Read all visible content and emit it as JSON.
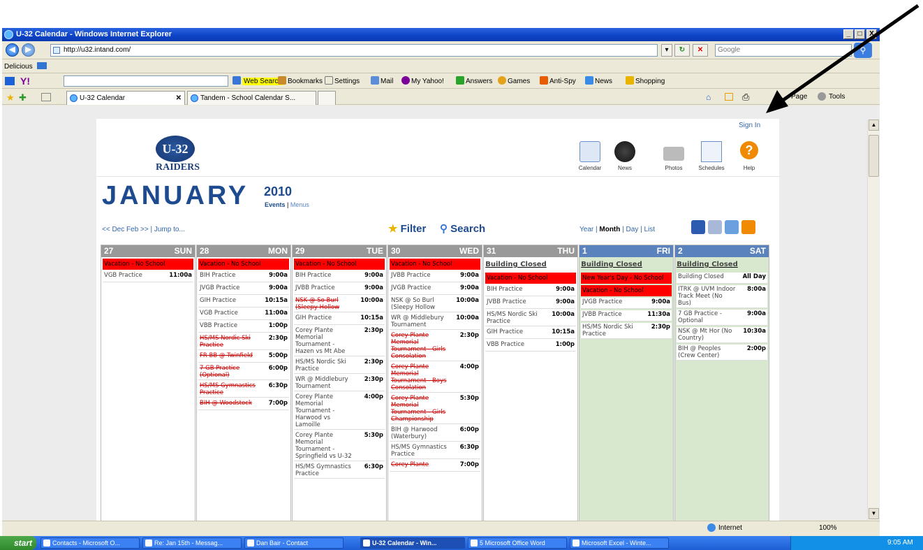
{
  "window": {
    "title": "U-32 Calendar - Windows Internet Explorer",
    "min": "_",
    "max": "□",
    "close": "X"
  },
  "address": {
    "url": "http://u32.intand.com/",
    "search_placeholder": "Google"
  },
  "delicious": {
    "label": "Delicious"
  },
  "yahoo_toolbar": {
    "items": [
      "Web Search",
      "Bookmarks",
      "Settings",
      "Mail",
      "My Yahoo!",
      "Answers",
      "Games",
      "Anti-Spy",
      "News",
      "Shopping"
    ]
  },
  "tabs": {
    "tab1": "U-32 Calendar",
    "tab2": "Tandem - School Calendar S...",
    "page_menu": "Page",
    "tools_menu": "Tools"
  },
  "page": {
    "sign_in": "Sign In",
    "logo": "U-32",
    "raiders": "RAIDERS",
    "nav": [
      "Calendar",
      "News",
      "Photos",
      "Schedules",
      "Help"
    ],
    "month": "JANUARY",
    "year": "2010",
    "events_link": "Events",
    "sep": "|",
    "menus_link": "Menus",
    "prev_next": "<< Dec   Feb >>  |  Jump to...",
    "filter": "Filter",
    "search": "Search",
    "views": {
      "year": "Year",
      "month": "Month",
      "day": "Day",
      "list": "List"
    }
  },
  "calendar": {
    "days": [
      {
        "num": "27",
        "name": "SUN",
        "events": [
          {
            "name": "Vacation - No School",
            "time": "",
            "style": "red"
          },
          {
            "name": "VGB Practice",
            "time": "11:00a",
            "style": ""
          }
        ]
      },
      {
        "num": "28",
        "name": "MON",
        "events": [
          {
            "name": "Vacation - No School",
            "time": "",
            "style": "red"
          },
          {
            "name": "BIH Practice",
            "time": "9:00a",
            "style": ""
          },
          {
            "name": "JVGB Practice",
            "time": "9:00a",
            "style": ""
          },
          {
            "name": "GIH Practice",
            "time": "10:15a",
            "style": ""
          },
          {
            "name": "VGB Practice",
            "time": "11:00a",
            "style": ""
          },
          {
            "name": "VBB Practice",
            "time": "1:00p",
            "style": ""
          },
          {
            "name": "HS/MS Nordic Ski Practice",
            "time": "2:30p",
            "style": "x"
          },
          {
            "name": "FR BB @ Twinfield",
            "time": "5:00p",
            "style": "x"
          },
          {
            "name": "7 GB Practice (Optional)",
            "time": "6:00p",
            "style": "x"
          },
          {
            "name": "HS/MS Gymnastics Practice",
            "time": "6:30p",
            "style": "x"
          },
          {
            "name": "BIH @ Woodstock",
            "time": "7:00p",
            "style": "x"
          }
        ]
      },
      {
        "num": "29",
        "name": "TUE",
        "events": [
          {
            "name": "Vacation - No School",
            "time": "",
            "style": "red"
          },
          {
            "name": "BIH Practice",
            "time": "9:00a",
            "style": ""
          },
          {
            "name": "JVBB Practice",
            "time": "9:00a",
            "style": ""
          },
          {
            "name": "NSK @ So Burl (Sleepy Hollow",
            "time": "10:00a",
            "style": "x"
          },
          {
            "name": "GIH Practice",
            "time": "10:15a",
            "style": ""
          },
          {
            "name": "Corey Plante Memorial Tournament - Hazen vs Mt Abe",
            "time": "2:30p",
            "style": ""
          },
          {
            "name": "HS/MS Nordic Ski Practice",
            "time": "2:30p",
            "style": ""
          },
          {
            "name": "WR @ Middlebury Tournament",
            "time": "2:30p",
            "style": ""
          },
          {
            "name": "Corey Plante Memorial Tournament - Harwood vs Lamoille",
            "time": "4:00p",
            "style": ""
          },
          {
            "name": "Corey Plante Memorial Tournament - Springfield vs U-32",
            "time": "5:30p",
            "style": ""
          },
          {
            "name": "HS/MS Gymnastics Practice",
            "time": "6:30p",
            "style": ""
          }
        ]
      },
      {
        "num": "30",
        "name": "WED",
        "events": [
          {
            "name": "Vacation - No School",
            "time": "",
            "style": "red"
          },
          {
            "name": "JVBB Practice",
            "time": "9:00a",
            "style": ""
          },
          {
            "name": "JVGB Practice",
            "time": "9:00a",
            "style": ""
          },
          {
            "name": "NSK @ So Burl (Sleepy Hollow",
            "time": "10:00a",
            "style": ""
          },
          {
            "name": "WR @ Middlebury Tournament",
            "time": "10:00a",
            "style": ""
          },
          {
            "name": "Corey Plante Memorial Tournament - Girls Consolation",
            "time": "2:30p",
            "style": "x"
          },
          {
            "name": "Corey Plante Memorial Tournament - Boys Consolation",
            "time": "4:00p",
            "style": "x"
          },
          {
            "name": "Corey Plante Memorial Tournament - Girls Championship",
            "time": "5:30p",
            "style": "x"
          },
          {
            "name": "BIH @ Harwood (Waterbury)",
            "time": "6:00p",
            "style": ""
          },
          {
            "name": "HS/MS Gymnastics Practice",
            "time": "6:30p",
            "style": ""
          },
          {
            "name": "Corey Plante",
            "time": "7:00p",
            "style": "x"
          }
        ]
      },
      {
        "num": "31",
        "name": "THU",
        "events": [
          {
            "name": "Building Closed",
            "time": "",
            "style": "closed"
          },
          {
            "name": "Vacation - No School",
            "time": "",
            "style": "red"
          },
          {
            "name": "BIH Practice",
            "time": "9:00a",
            "style": ""
          },
          {
            "name": "JVBB Practice",
            "time": "9:00a",
            "style": ""
          },
          {
            "name": "HS/MS Nordic Ski Practice",
            "time": "10:00a",
            "style": ""
          },
          {
            "name": "GIH Practice",
            "time": "10:15a",
            "style": ""
          },
          {
            "name": "VBB Practice",
            "time": "1:00p",
            "style": ""
          }
        ]
      },
      {
        "num": "1",
        "name": "FRI",
        "highlight": true,
        "events": [
          {
            "name": "Building Closed",
            "time": "",
            "style": "closed"
          },
          {
            "name": "New Year's Day - No School",
            "time": "",
            "style": "red"
          },
          {
            "name": "Vacation - No School",
            "time": "",
            "style": "red"
          },
          {
            "name": "JVGB Practice",
            "time": "9:00a",
            "style": ""
          },
          {
            "name": "JVBB Practice",
            "time": "11:30a",
            "style": ""
          },
          {
            "name": "HS/MS Nordic Ski Practice",
            "time": "2:30p",
            "style": ""
          }
        ]
      },
      {
        "num": "2",
        "name": "SAT",
        "highlight": true,
        "events": [
          {
            "name": "Building Closed",
            "time": "",
            "style": "closed"
          },
          {
            "name": "Building Closed",
            "time": "All Day",
            "style": ""
          },
          {
            "name": "ITRK @ UVM Indoor Track Meet (No Bus)",
            "time": "8:00a",
            "style": ""
          },
          {
            "name": "7 GB Practice - Optional",
            "time": "9:00a",
            "style": ""
          },
          {
            "name": "NSK @ Mt Hor (No Country)",
            "time": "10:30a",
            "style": ""
          },
          {
            "name": "BIH @ Peoples (Crew Center)",
            "time": "2:00p",
            "style": ""
          }
        ]
      }
    ]
  },
  "status": {
    "zone": "Internet",
    "zoom": "100%"
  },
  "taskbar": {
    "start": "start",
    "tasks": [
      "Contacts - Microsoft O...",
      "Re: Jan 15th - Messag...",
      "Dan Bair - Contact",
      "U-32 Calendar - Win...",
      "5 Microsoft Office Word",
      "Microsoft Excel - Winte..."
    ],
    "clock": "9:05 AM"
  },
  "colors": {
    "accent": "#1e4a8f",
    "vacation": "#ff0000",
    "highlight": "#d8e8ce"
  }
}
